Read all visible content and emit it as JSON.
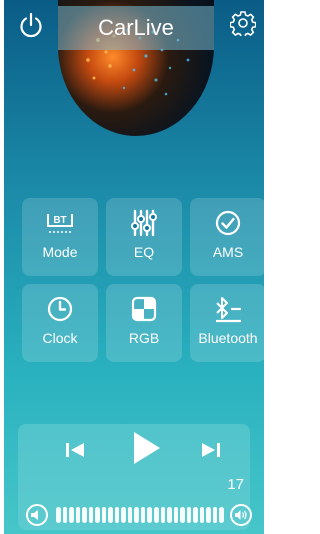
{
  "app": {
    "title": "CarLive"
  },
  "icons": {
    "power": "power-icon",
    "settings": "gear-icon"
  },
  "functions": [
    {
      "id": "mode",
      "label": "Mode",
      "icon": "bt-mode-icon",
      "icon_text": "BT"
    },
    {
      "id": "eq",
      "label": "EQ",
      "icon": "equalizer-sliders-icon"
    },
    {
      "id": "ams",
      "label": "AMS",
      "icon": "check-circle-icon"
    },
    {
      "id": "clock",
      "label": "Clock",
      "icon": "clock-icon"
    },
    {
      "id": "rgb",
      "label": "RGB",
      "icon": "rgb-quadrant-icon"
    },
    {
      "id": "bluetooth",
      "label": "Bluetooth",
      "icon": "bluetooth-list-icon"
    }
  ],
  "player": {
    "prev_icon": "skip-previous-icon",
    "play_icon": "play-icon",
    "next_icon": "skip-next-icon",
    "volume": {
      "value": "17",
      "level_fraction": 1.0,
      "segments": 26,
      "down_icon": "volume-down-icon",
      "up_icon": "volume-up-icon"
    }
  },
  "colors": {
    "accent": "#ffffff",
    "background_top": "#0a5c86",
    "background_bottom": "#46c6c9"
  }
}
